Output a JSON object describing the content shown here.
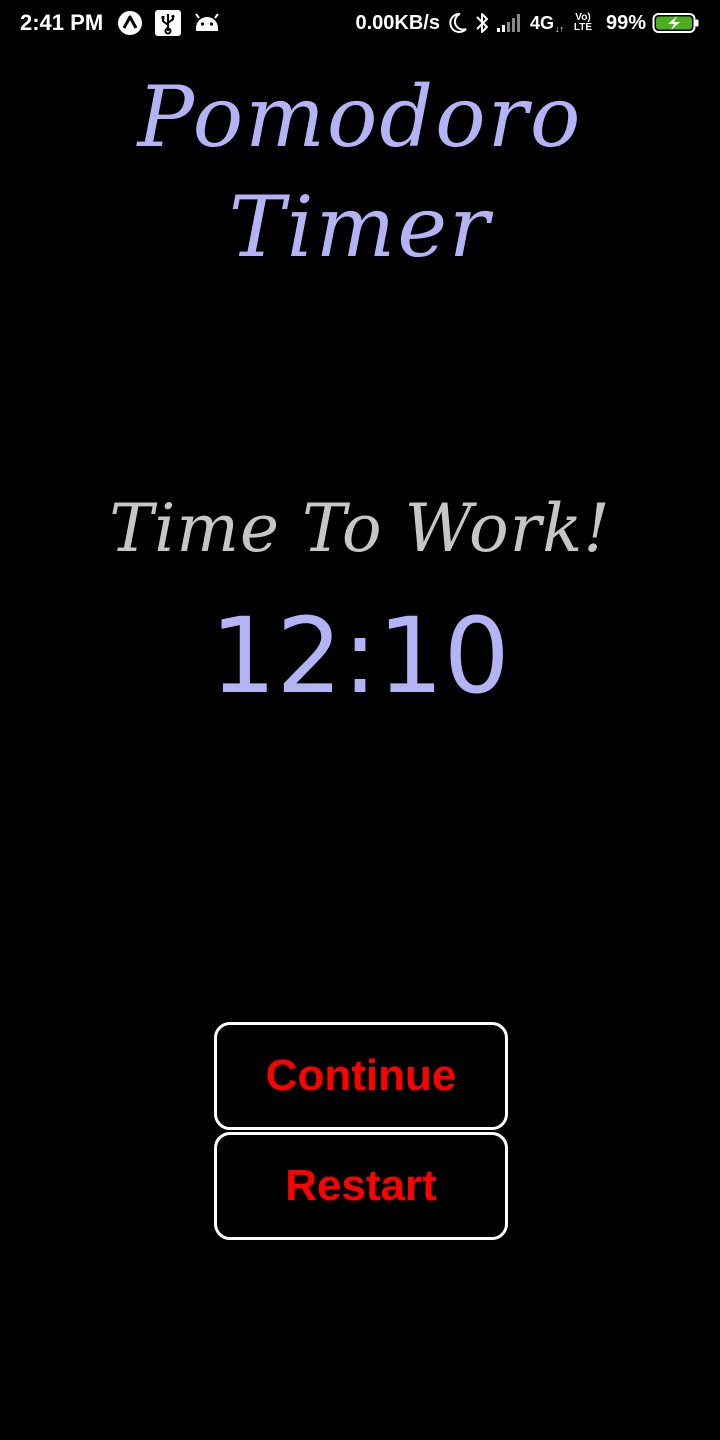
{
  "status_bar": {
    "time": "2:41 PM",
    "network_speed": "0.00KB/s",
    "network_type": "4G",
    "network_sub": "↓↑",
    "volte_top": "Vo)",
    "volte_bottom": "LTE",
    "battery": "99%",
    "icons": [
      "notification-a-icon",
      "usb-icon",
      "android-icon",
      "moon-icon",
      "bluetooth-icon",
      "signal-icon",
      "battery-charging-icon"
    ],
    "colors": {
      "battery_fill": "#4caf1f"
    }
  },
  "app": {
    "title": "Pomodoro Timer",
    "mode_label": "Time To Work!",
    "timer": "12:10",
    "colors": {
      "accent": "#b3b3f5",
      "mode_text": "#c6c6c6",
      "button_text": "#ff0000",
      "background": "#000000"
    }
  },
  "buttons": {
    "continue_label": "Continue",
    "restart_label": "Restart"
  }
}
